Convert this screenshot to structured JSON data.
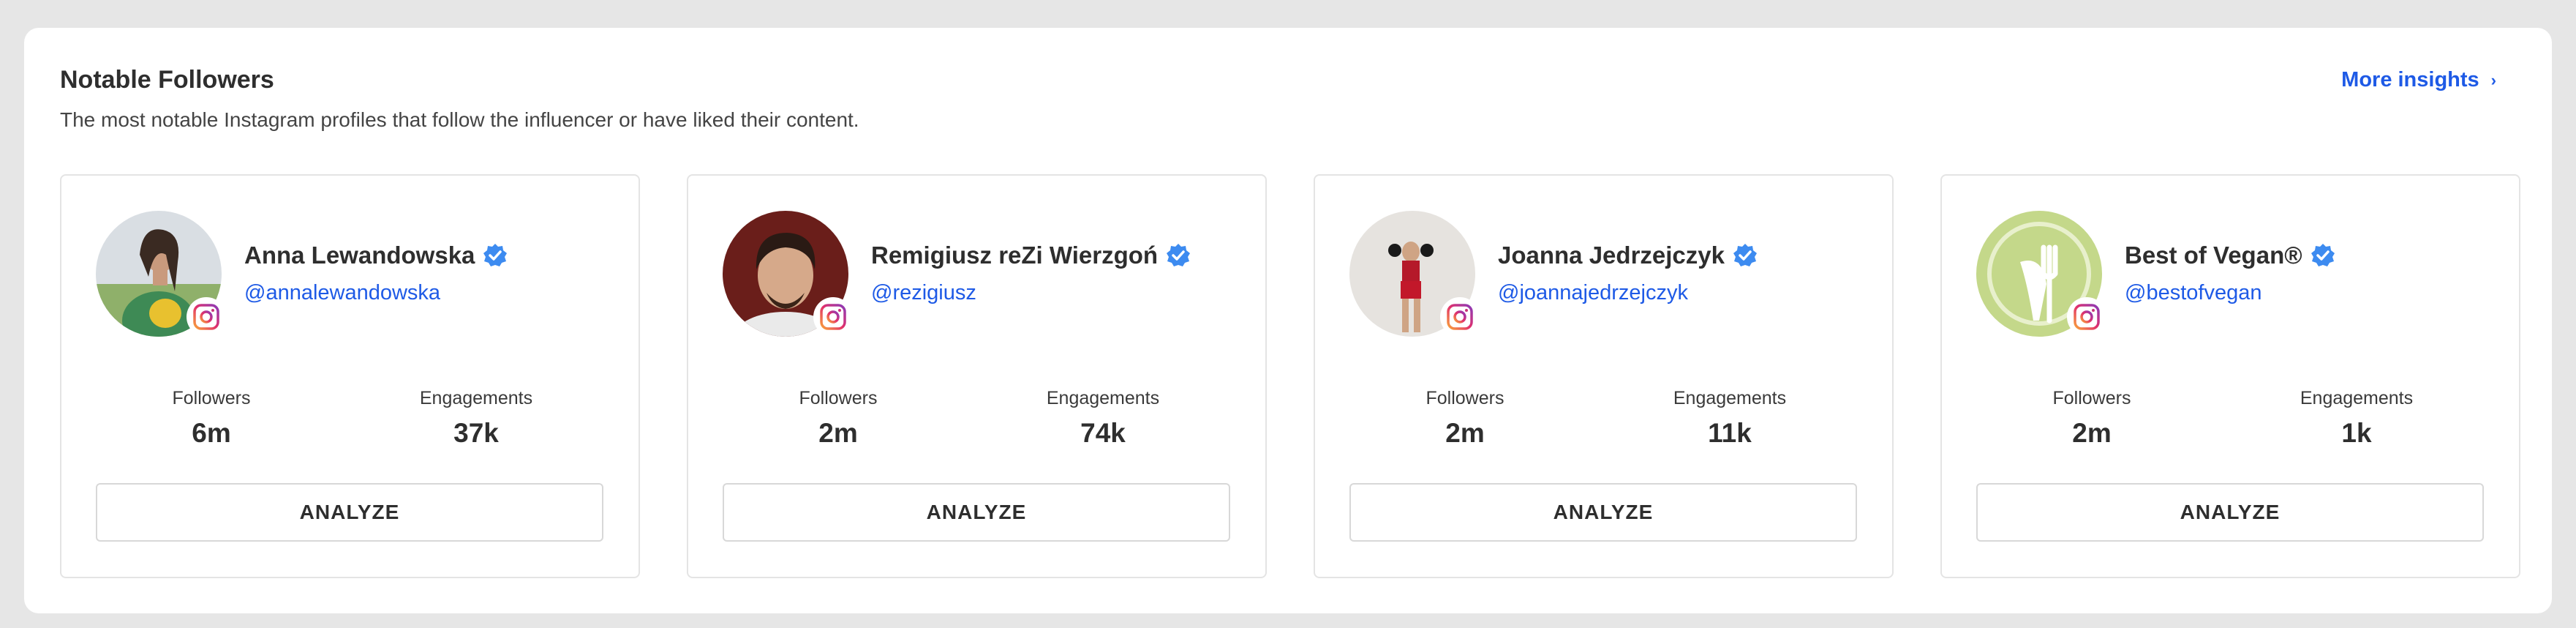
{
  "panel": {
    "title": "Notable Followers",
    "subtitle": "The most notable Instagram profiles that follow the influencer or have liked their content.",
    "more_link": "More insights"
  },
  "followers": [
    {
      "name": "Anna Lewandowska",
      "handle": "@annalewandowska",
      "followers_label": "Followers",
      "followers": "6m",
      "engagements_label": "Engagements",
      "engagements": "37k",
      "button": "ANALYZE",
      "verified": true
    },
    {
      "name": "Remigiusz reZi Wierzgoń",
      "handle": "@rezigiusz",
      "followers_label": "Followers",
      "followers": "2m",
      "engagements_label": "Engagements",
      "engagements": "74k",
      "button": "ANALYZE",
      "verified": true
    },
    {
      "name": "Joanna Jedrzejczyk",
      "handle": "@joannajedrzejczyk",
      "followers_label": "Followers",
      "followers": "2m",
      "engagements_label": "Engagements",
      "engagements": "11k",
      "button": "ANALYZE",
      "verified": true
    },
    {
      "name": "Best of Vegan®",
      "handle": "@bestofvegan",
      "followers_label": "Followers",
      "followers": "2m",
      "engagements_label": "Engagements",
      "engagements": "1k",
      "button": "ANALYZE",
      "verified": true
    }
  ],
  "icons": {
    "verified": "verified-badge-icon",
    "platform": "instagram-icon",
    "more": "chevron-right-icon"
  },
  "colors": {
    "link": "#1e5ae6",
    "verified": "#3d8bf0"
  }
}
